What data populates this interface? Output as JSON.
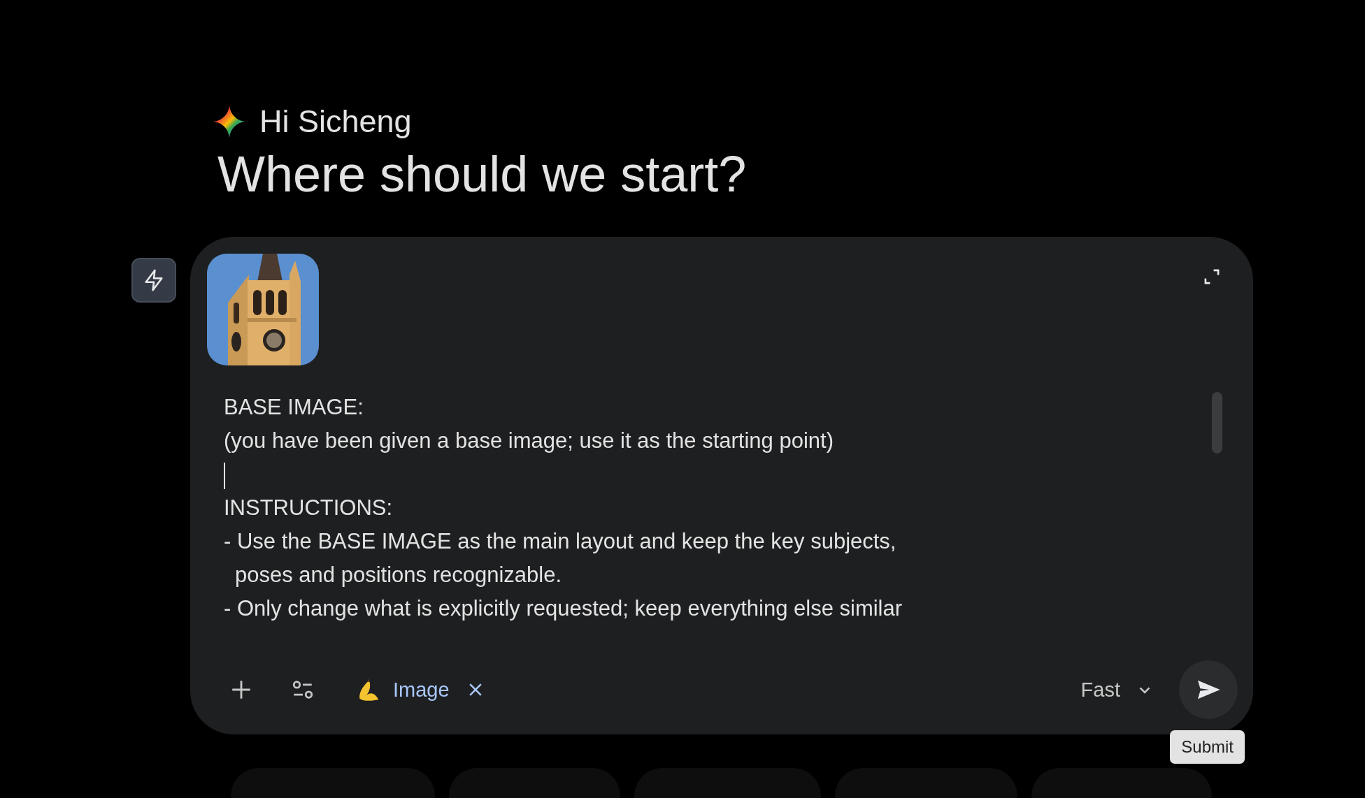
{
  "greeting": "Hi Sicheng",
  "headline": "Where should we start?",
  "composer": {
    "lines": [
      {
        "kind": "text",
        "text": "BASE IMAGE:"
      },
      {
        "kind": "text",
        "text": "(you have been given a base image; use it as the starting point)"
      },
      {
        "kind": "caret"
      },
      {
        "kind": "text",
        "text": "INSTRUCTIONS:"
      },
      {
        "kind": "text",
        "text": "- Use the BASE IMAGE as the main layout and keep the key subjects,"
      },
      {
        "kind": "indent",
        "text": "poses and positions recognizable."
      },
      {
        "kind": "text",
        "text": "- Only change what is explicitly requested; keep everything else similar"
      }
    ],
    "tool_chip": {
      "label": "Image"
    },
    "mode": "Fast",
    "tooltip": "Submit"
  },
  "suggestion_chips": [
    {
      "kind": "blank"
    },
    {
      "kind": "blank"
    },
    {
      "kind": "blank"
    },
    {
      "kind": "blank"
    },
    {
      "kind": "blank"
    }
  ]
}
